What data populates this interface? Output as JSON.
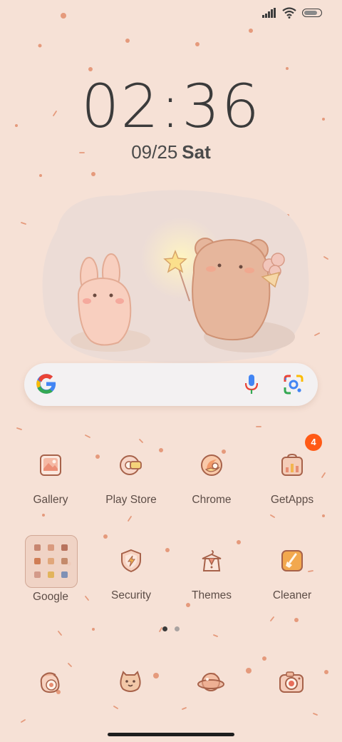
{
  "status_bar": {
    "signal_icon": "signal-icon",
    "wifi_icon": "wifi-icon",
    "battery_icon": "battery-icon"
  },
  "clock": {
    "time": "02:36",
    "date": "09/25",
    "day": "Sat"
  },
  "search_bar": {
    "logo": "google-g-icon",
    "mic_icon": "microphone-icon",
    "lens_icon": "google-lens-icon"
  },
  "apps_row1": [
    {
      "label": "Gallery",
      "icon": "gallery-icon"
    },
    {
      "label": "Play Store",
      "icon": "play-store-icon"
    },
    {
      "label": "Chrome",
      "icon": "chrome-icon"
    },
    {
      "label": "GetApps",
      "icon": "getapps-icon",
      "badge": "4"
    }
  ],
  "apps_row2": [
    {
      "label": "Google",
      "icon": "folder-icon"
    },
    {
      "label": "Security",
      "icon": "security-icon"
    },
    {
      "label": "Themes",
      "icon": "themes-icon"
    },
    {
      "label": "Cleaner",
      "icon": "cleaner-icon"
    }
  ],
  "page_indicator": {
    "pages": 2,
    "current": 1
  },
  "dock": [
    "dock-app-1-icon",
    "messages-icon",
    "browser-icon",
    "camera-icon"
  ],
  "colors": {
    "background": "#f6e1d6",
    "icon_line": "#a7624a",
    "badge": "#ff5a16"
  }
}
